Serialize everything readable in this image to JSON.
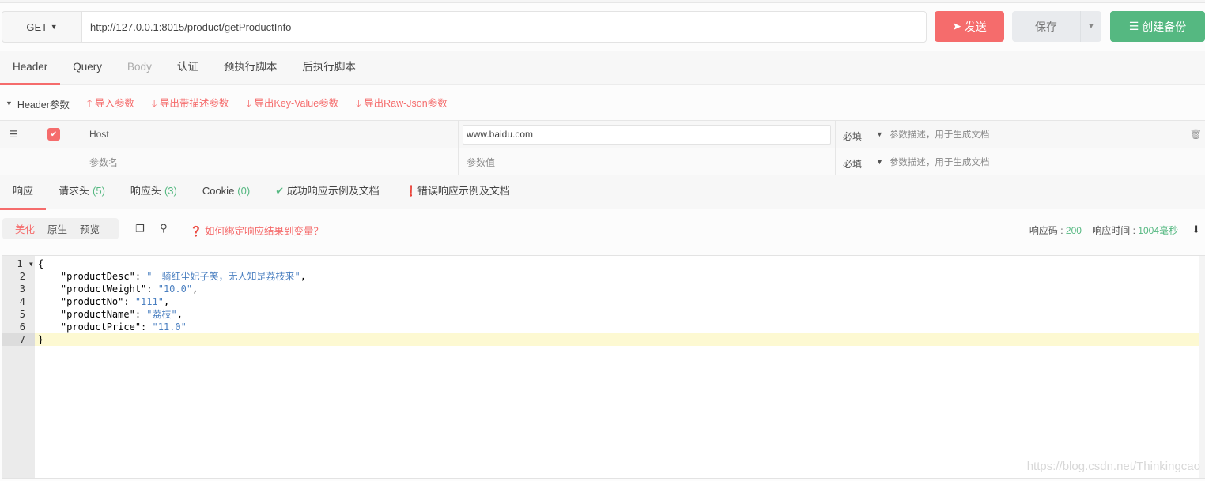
{
  "request": {
    "method": "GET",
    "url": "http://127.0.0.1:8015/product/getProductInfo",
    "send_label": "发送",
    "save_label": "保存",
    "backup_label": "创建备份"
  },
  "request_tabs": [
    {
      "label": "Header"
    },
    {
      "label": "Query"
    },
    {
      "label": "Body"
    },
    {
      "label": "认证"
    },
    {
      "label": "预执行脚本"
    },
    {
      "label": "后执行脚本"
    }
  ],
  "header_section": {
    "title": "Header参数",
    "actions": [
      "导入参数",
      "导出带描述参数",
      "导出Key-Value参数",
      "导出Raw-Json参数"
    ]
  },
  "header_rows": [
    {
      "name": "Host",
      "value": "www.baidu.com",
      "required": "必填",
      "desc_placeholder": "参数描述，用于生成文档",
      "checked": true
    }
  ],
  "new_row": {
    "name_placeholder": "参数名",
    "value_placeholder": "参数值",
    "required": "必填",
    "desc_placeholder": "参数描述，用于生成文档"
  },
  "response_tabs": [
    {
      "label": "响应"
    },
    {
      "label": "请求头",
      "count": "(5)"
    },
    {
      "label": "响应头",
      "count": "(3)"
    },
    {
      "label": "Cookie",
      "count": "(0)"
    },
    {
      "label": "成功响应示例及文档"
    },
    {
      "label": "错误响应示例及文档"
    }
  ],
  "view_modes": [
    "美化",
    "原生",
    "预览"
  ],
  "help_link": "如何绑定响应结果到变量？",
  "status": {
    "code_label": "响应码 : ",
    "code": "200",
    "time_label": "响应时间 : ",
    "time": "1004毫秒"
  },
  "code_lines": [
    [
      {
        "t": "{"
      }
    ],
    [
      {
        "t": "    \"productDesc\": "
      },
      {
        "s": "\"一骑红尘妃子笑，无人知是荔枝来\""
      },
      {
        "t": ","
      }
    ],
    [
      {
        "t": "    \"productWeight\": "
      },
      {
        "s": "\"10.0\""
      },
      {
        "t": ","
      }
    ],
    [
      {
        "t": "    \"productNo\": "
      },
      {
        "s": "\"111\""
      },
      {
        "t": ","
      }
    ],
    [
      {
        "t": "    \"productName\": "
      },
      {
        "s": "\"荔枝\""
      },
      {
        "t": ","
      }
    ],
    [
      {
        "t": "    \"productPrice\": "
      },
      {
        "s": "\"11.0\""
      }
    ],
    [
      {
        "t": "}"
      }
    ]
  ],
  "watermark": "https://blog.csdn.net/Thinkingcao",
  "colors": {
    "accent": "#f56c6c",
    "success": "#55b881"
  }
}
